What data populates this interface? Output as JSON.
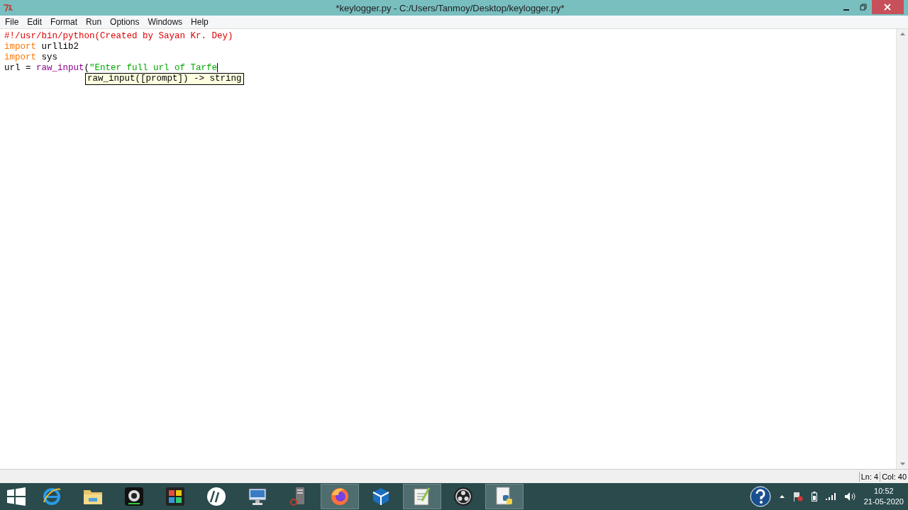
{
  "window": {
    "title": "*keylogger.py - C:/Users/Tanmoy/Desktop/keylogger.py*"
  },
  "menu": [
    "File",
    "Edit",
    "Format",
    "Run",
    "Options",
    "Windows",
    "Help"
  ],
  "editor": {
    "lines": [
      [
        {
          "kind": "comment",
          "text": "#!/usr/bin/python(Created by Sayan Kr. Dey)"
        }
      ],
      [
        {
          "kind": "keyword",
          "text": "import"
        },
        {
          "kind": "plain",
          "text": " urllib2"
        }
      ],
      [
        {
          "kind": "keyword",
          "text": "import"
        },
        {
          "kind": "plain",
          "text": " sys"
        }
      ],
      [
        {
          "kind": "plain",
          "text": "url = "
        },
        {
          "kind": "builtin",
          "text": "raw_input"
        },
        {
          "kind": "plain",
          "text": "("
        },
        {
          "kind": "string",
          "text": "\"Enter full url of Tarfe"
        }
      ]
    ],
    "calltip": "raw_input([prompt]) -> string"
  },
  "status_bar": {
    "line": "Ln: 4",
    "column": "Col: 40"
  },
  "taskbar": {
    "apps": [
      {
        "kind": "ie",
        "selected": false
      },
      {
        "kind": "folder",
        "selected": false
      },
      {
        "kind": "webcam",
        "selected": false
      },
      {
        "kind": "puzzle",
        "selected": false
      },
      {
        "kind": "hp",
        "selected": false
      },
      {
        "kind": "monitor",
        "selected": false
      },
      {
        "kind": "server",
        "selected": false
      },
      {
        "kind": "firefox",
        "selected": true
      },
      {
        "kind": "cube",
        "selected": false
      },
      {
        "kind": "notepad",
        "selected": true
      },
      {
        "kind": "obs",
        "selected": false
      },
      {
        "kind": "python",
        "selected": true
      }
    ],
    "time": "10:52",
    "date": "21-05-2020"
  }
}
